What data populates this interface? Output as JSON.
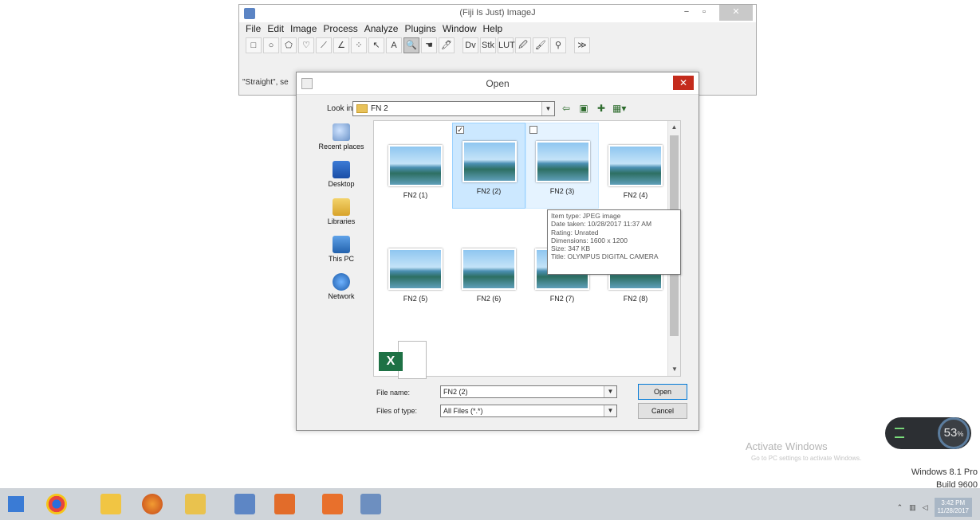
{
  "imagej": {
    "title": "(Fiji Is Just) ImageJ",
    "min": "−",
    "max": "▫",
    "close": "✕",
    "menu": [
      "File",
      "Edit",
      "Image",
      "Process",
      "Analyze",
      "Plugins",
      "Window",
      "Help"
    ],
    "tools": [
      "□",
      "○",
      "⬠",
      "♡",
      "⟋",
      "∠",
      "⁘",
      "↖",
      "A",
      "🔍",
      "☚",
      "🖊",
      "Dv",
      "Stk",
      "LUT",
      "🖉",
      "🖌",
      "⚲",
      "≫"
    ],
    "status": "\"Straight\", se"
  },
  "dialog": {
    "title": "Open",
    "close": "✕",
    "look_in_label": "Look in:",
    "look_in_value": "FN 2",
    "nav_icons": [
      "⇦",
      "▣",
      "✚",
      "▦▾"
    ],
    "places": [
      {
        "label": "Recent places",
        "icon": "recent-places-icon"
      },
      {
        "label": "Desktop",
        "icon": "desktop-icon"
      },
      {
        "label": "Libraries",
        "icon": "libraries-icon"
      },
      {
        "label": "This PC",
        "icon": "this-pc-icon"
      },
      {
        "label": "Network",
        "icon": "network-icon"
      }
    ],
    "files": [
      "FN2 (1)",
      "FN2 (2)",
      "FN2 (3)",
      "FN2 (4)",
      "FN2 (5)",
      "FN2 (6)",
      "FN2 (7)",
      "FN2 (8)"
    ],
    "checkbox_checked": "✓",
    "tooltip": [
      "Item type: JPEG image",
      "Date taken: 10/28/2017 11:37 AM",
      "Rating: Unrated",
      "Dimensions: 1600 x 1200",
      "Size: 347 KB",
      "Title: OLYMPUS DIGITAL CAMERA"
    ],
    "file_name_label": "File name:",
    "file_name_value": "FN2 (2)",
    "file_type_label": "Files of type:",
    "file_type_value": "All Files (*.*)",
    "open_button": "Open",
    "cancel_button": "Cancel",
    "scroll_up": "▲",
    "scroll_down": "▼",
    "combo_arrow": "▼"
  },
  "desktop": {
    "activate_title": "Activate Windows",
    "activate_sub": "Go to PC settings to activate Windows.",
    "version_line1": "Windows 8.1 Pro",
    "version_line2": "Build 9600",
    "meter_value": "53",
    "meter_unit": "%"
  },
  "taskbar": {
    "clock_time": "3:42 PM",
    "clock_date": "11/28/2017"
  },
  "colors": {
    "accent": "#0078d7",
    "close_red": "#c42b1c",
    "selection": "#cce8ff"
  }
}
